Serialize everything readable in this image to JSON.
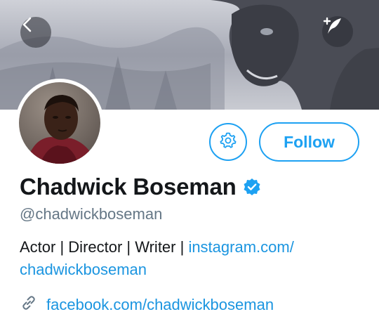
{
  "header": {
    "back_icon": "chevron-left-icon",
    "compose_icon": "compose-tweet-icon"
  },
  "profile": {
    "display_name": "Chadwick Boseman",
    "verified": true,
    "handle": "@chadwickboseman",
    "bio_text": "Actor | Director | Writer | ",
    "bio_link_line1": "instagram.com/",
    "bio_link_line2": "chadwickboseman",
    "website": "facebook.com/chadwickboseman"
  },
  "actions": {
    "settings_icon": "gear-icon",
    "follow_label": "Follow"
  },
  "colors": {
    "accent": "#1da1f2",
    "link": "#1b95e0",
    "name": "#14171a",
    "handle": "#657786"
  }
}
